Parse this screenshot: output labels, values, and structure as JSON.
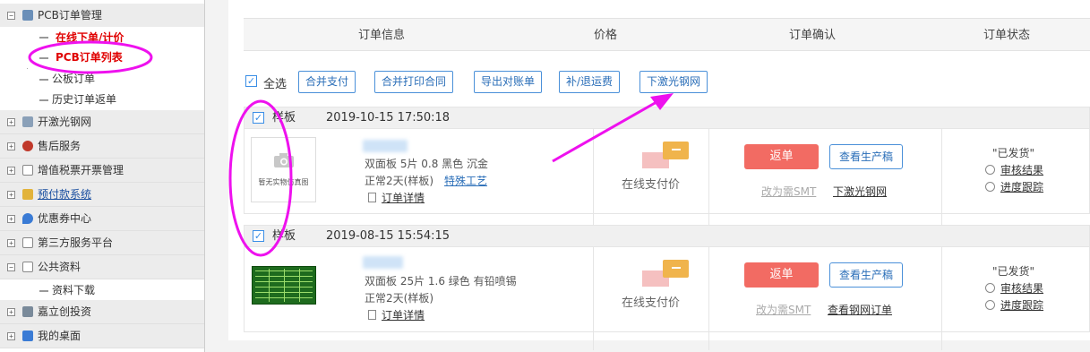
{
  "sidebar": {
    "top_item": {
      "label": "PCB订单管理"
    },
    "sub_items": [
      {
        "label": "在线下单/计价"
      },
      {
        "label": "PCB订单列表"
      },
      {
        "label": "公板订单"
      },
      {
        "label": "历史订单返单"
      }
    ],
    "groups": [
      {
        "label": "开激光钢网"
      },
      {
        "label": "售后服务"
      },
      {
        "label": "增值税票开票管理"
      },
      {
        "label": "预付款系统"
      },
      {
        "label": "优惠券中心"
      },
      {
        "label": "第三方服务平台"
      },
      {
        "label": "公共资料"
      }
    ],
    "public_sub": {
      "label": "资料下载"
    },
    "bottom_groups": [
      {
        "label": "嘉立创投资"
      },
      {
        "label": "我的桌面"
      }
    ]
  },
  "table_header": {
    "col_info": "订单信息",
    "col_price": "价格",
    "col_confirm": "订单确认",
    "col_status": "订单状态"
  },
  "toolbar": {
    "select_all": "全选",
    "buttons": [
      "合并支付",
      "合并打印合同",
      "导出对账单",
      "补/退运费",
      "下激光钢网"
    ]
  },
  "orders": [
    {
      "label": "样板",
      "time": "2019-10-15 17:50:18",
      "thumb_text": "暂无实物仿真图",
      "spec": "双面板   5片   0.8   黑色   沉金",
      "delivery": "正常2天(样板)",
      "special": "特殊工艺",
      "detail": "订单详情",
      "pay": "在线支付价",
      "reorder": "返单",
      "view_draft": "查看生产稿",
      "smt": "改为需SMT",
      "mesh": "下激光钢网",
      "status": "\"已发货\"",
      "audit": "审核结果",
      "progress": "进度跟踪"
    },
    {
      "label": "样板",
      "time": "2019-08-15 15:54:15",
      "spec": "双面板   25片   1.6   绿色   有铅喷锡",
      "delivery": "正常2天(样板)",
      "detail": "订单详情",
      "pay": "在线支付价",
      "reorder": "返单",
      "view_draft": "查看生产稿",
      "smt": "改为需SMT",
      "mesh": "查看钢网订单",
      "status": "\"已发货\"",
      "audit": "审核结果",
      "progress": "进度跟踪"
    }
  ],
  "colors": {
    "accent_blue": "#2a6eb8",
    "annotation_magenta": "#ee11ee",
    "reorder_red": "#f26b63",
    "active_menu_red": "#e00000"
  }
}
